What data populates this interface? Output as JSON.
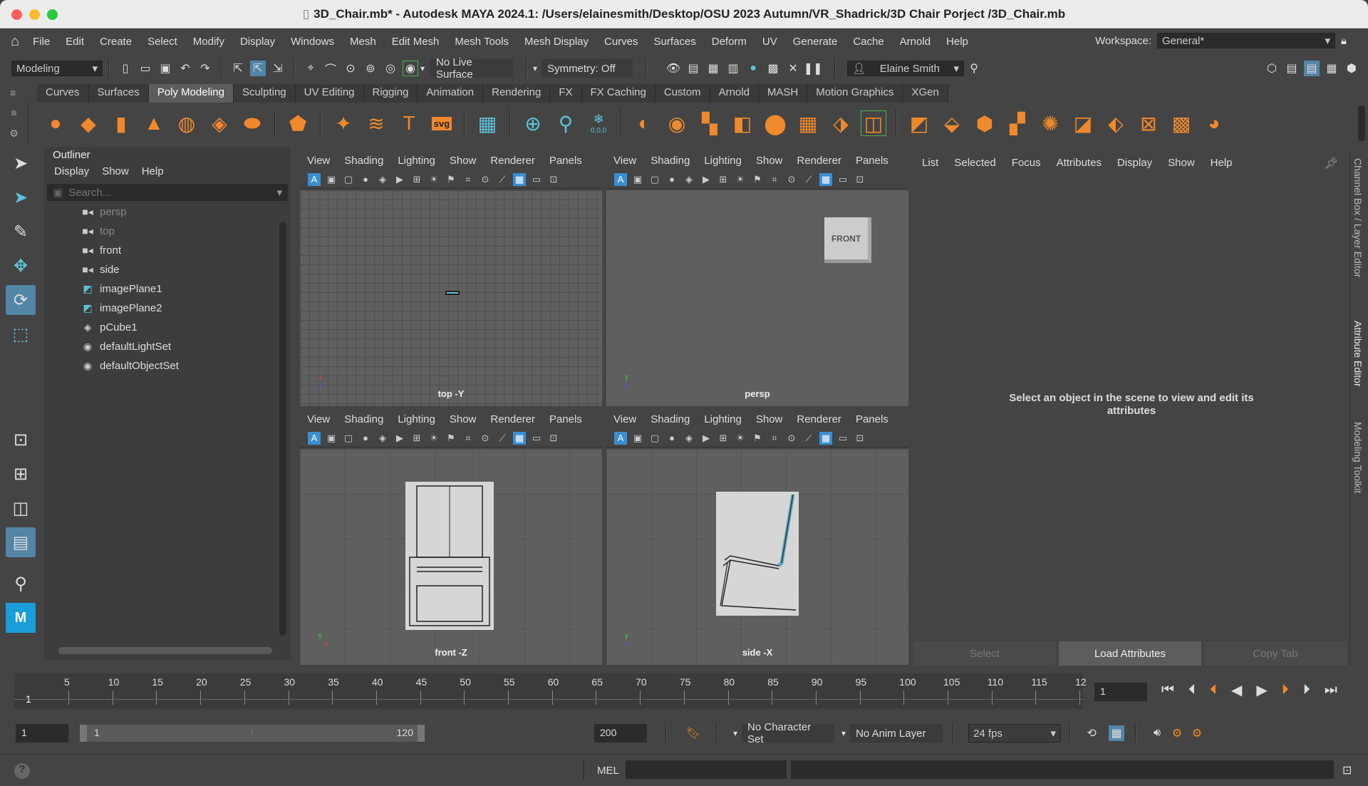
{
  "window": {
    "title": "3D_Chair.mb* - Autodesk MAYA 2024.1: /Users/elainesmith/Desktop/OSU 2023 Autumn/VR_Shadrick/3D Chair Porject /3D_Chair.mb"
  },
  "menu": [
    "File",
    "Edit",
    "Create",
    "Select",
    "Modify",
    "Display",
    "Windows",
    "Mesh",
    "Edit Mesh",
    "Mesh Tools",
    "Mesh Display",
    "Curves",
    "Surfaces",
    "Deform",
    "UV",
    "Generate",
    "Cache",
    "Arnold",
    "Help"
  ],
  "workspace": {
    "label": "Workspace:",
    "value": "General*"
  },
  "status": {
    "mode": "Modeling",
    "live_surface": "No Live Surface",
    "symmetry": "Symmetry: Off",
    "user": "Elaine Smith"
  },
  "shelf_tabs": [
    "Curves",
    "Surfaces",
    "Poly Modeling",
    "Sculpting",
    "UV Editing",
    "Rigging",
    "Animation",
    "Rendering",
    "FX",
    "FX Caching",
    "Custom",
    "Arnold",
    "MASH",
    "Motion Graphics",
    "XGen"
  ],
  "shelf_active": "Poly Modeling",
  "shelf_text": {
    "svg": "svg",
    "coords": "0,0,0",
    "type": "T"
  },
  "outliner": {
    "title": "Outliner",
    "menu": [
      "Display",
      "Show",
      "Help"
    ],
    "search_placeholder": "Search...",
    "items": [
      {
        "label": "persp",
        "icon": "camera-icon",
        "dim": true
      },
      {
        "label": "top",
        "icon": "camera-icon",
        "dim": true
      },
      {
        "label": "front",
        "icon": "camera-icon",
        "dim": false
      },
      {
        "label": "side",
        "icon": "camera-icon",
        "dim": false
      },
      {
        "label": "imagePlane1",
        "icon": "image-plane-icon",
        "dim": false
      },
      {
        "label": "imagePlane2",
        "icon": "image-plane-icon",
        "dim": false
      },
      {
        "label": "pCube1",
        "icon": "mesh-icon",
        "dim": false
      },
      {
        "label": "defaultLightSet",
        "icon": "set-icon",
        "dim": false
      },
      {
        "label": "defaultObjectSet",
        "icon": "set-icon",
        "dim": false
      }
    ]
  },
  "viewport_menu": [
    "View",
    "Shading",
    "Lighting",
    "Show",
    "Renderer",
    "Panels"
  ],
  "viewports": {
    "top": "top -Y",
    "persp": "persp",
    "front": "front -Z",
    "side": "side -X",
    "cube_label": "FRONT"
  },
  "attribute_editor": {
    "menu": [
      "List",
      "Selected",
      "Focus",
      "Attributes",
      "Display",
      "Show",
      "Help"
    ],
    "message": "Select an object in the scene to view and edit its attributes",
    "buttons": {
      "select": "Select",
      "load": "Load Attributes",
      "copy": "Copy Tab"
    }
  },
  "side_tabs": {
    "channel": "Channel Box / Layer Editor",
    "attribute": "Attribute Editor",
    "toolkit": "Modeling Toolkit"
  },
  "timeline": {
    "ticks": [
      "5",
      "10",
      "15",
      "20",
      "25",
      "30",
      "35",
      "40",
      "45",
      "50",
      "55",
      "60",
      "65",
      "70",
      "75",
      "80",
      "85",
      "90",
      "95",
      "100",
      "105",
      "110",
      "115",
      "12"
    ],
    "current_marker": "1",
    "current_frame": "1"
  },
  "range": {
    "start": "1",
    "inner_start": "1",
    "inner_end": "120",
    "end": "200",
    "character_set": "No Character Set",
    "anim_layer": "No Anim Layer",
    "fps": "24 fps"
  },
  "command": {
    "lang": "MEL"
  },
  "colors": {
    "accent": "#5285a6",
    "shelf_orange": "#f0892b",
    "shelf_blue": "#5fc1d9"
  }
}
